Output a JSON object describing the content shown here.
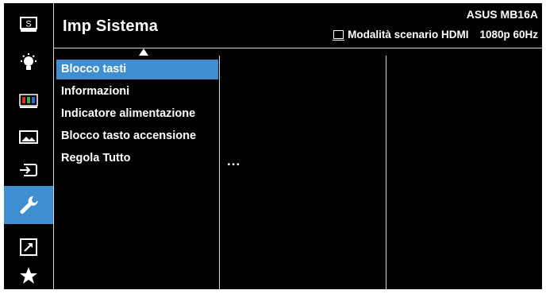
{
  "header": {
    "title": "Imp Sistema",
    "model": "ASUS MB16A",
    "mode": "Modalità scenario HDMI",
    "resolution": "1080p 60Hz",
    "mode_icon": "monitor-icon"
  },
  "rail": {
    "items": [
      {
        "name": "splendid-icon",
        "glyph": "S"
      },
      {
        "name": "brightness-icon"
      },
      {
        "name": "color-icon"
      },
      {
        "name": "image-icon"
      },
      {
        "name": "input-select-icon"
      },
      {
        "name": "system-setup-icon",
        "active": true
      },
      {
        "name": "shortcut-icon"
      },
      {
        "name": "myfavorite-icon"
      }
    ]
  },
  "menu": {
    "items": [
      {
        "label": "Blocco tasti",
        "selected": true
      },
      {
        "label": "Informazioni"
      },
      {
        "label": "Indicatore alimentazione"
      },
      {
        "label": "Blocco tasto accensione"
      },
      {
        "label": "Regola Tutto"
      }
    ],
    "more": "..."
  },
  "colors": {
    "background": "#000000",
    "accent": "#3f8fd0",
    "divider": "#d6d6d6"
  }
}
